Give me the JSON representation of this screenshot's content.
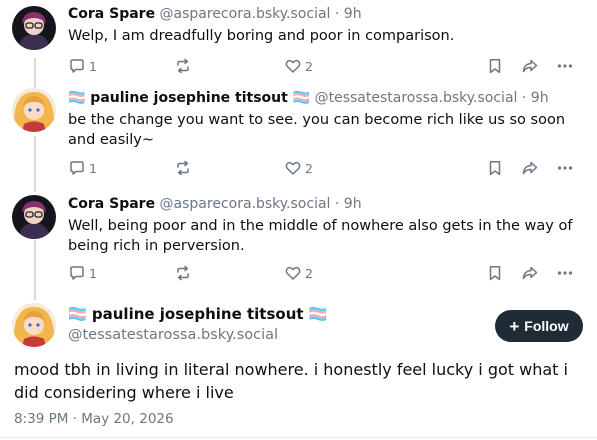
{
  "posts": [
    {
      "display_name": "Cora Spare",
      "handle": "@asparecora.bsky.social",
      "separator": " · ",
      "time": "9h",
      "text": "Welp, I am dreadfully boring and poor in comparison.",
      "reply_count": "1",
      "like_count": "2",
      "avatar": "cora-avatar"
    },
    {
      "display_name": "🏳️‍⚧️ pauline josephine titsout 🏳️‍⚧️",
      "handle": "@tessatestarossa.bsky.social",
      "separator": " · ",
      "time": "9h",
      "text": "be the change you want to see. you can become rich like us so soon and easily~",
      "reply_count": "1",
      "like_count": "2",
      "avatar": "pauline-avatar"
    },
    {
      "display_name": "Cora Spare",
      "handle": "@asparecora.bsky.social",
      "separator": " · ",
      "time": "9h",
      "text": "Well, being poor and in the middle of nowhere also gets in the way of being rich in perversion.",
      "reply_count": "1",
      "like_count": "2",
      "avatar": "cora-avatar"
    }
  ],
  "focus_post": {
    "display_name": "🏳️‍⚧️ pauline josephine titsout 🏳️‍⚧️",
    "handle": "@tessatestarossa.bsky.social",
    "follow_label": "Follow",
    "follow_prefix": "+",
    "text": "mood tbh in living in literal nowhere. i honestly feel lucky i got what i did considering where i live",
    "timestamp": "8:39 PM · May 20, 2026"
  },
  "colors": {
    "muted": "#6b7785",
    "thread_line": "#d4dbe2",
    "follow_bg": "#1f2b37"
  },
  "icons": [
    "reply-icon",
    "repost-icon",
    "like-icon",
    "bookmark-icon",
    "share-icon",
    "more-icon"
  ]
}
